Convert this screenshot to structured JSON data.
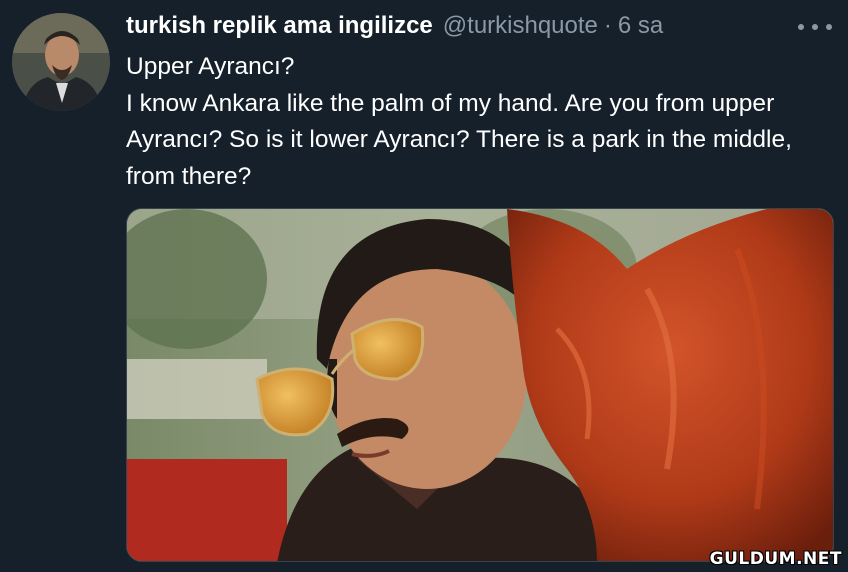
{
  "tweet": {
    "author": {
      "display_name": "turkish replik ama ingilizce",
      "handle": "@turkishquote",
      "avatar_icon": "profile-photo"
    },
    "separator": "·",
    "timestamp": "6 sa",
    "more_icon": "more-horizontal-icon",
    "text_line_1": "Upper Ayrancı?",
    "text_line_2": "I know Ankara like the palm of my hand. Are you from upper Ayrancı? So is it lower Ayrancı? There is a park in the middle, from there?",
    "media": {
      "description_icon": "movie-still-image"
    }
  },
  "watermark": "GULDUM.NET",
  "colors": {
    "background": "#15202b",
    "primary_text": "#ffffff",
    "secondary_text": "#8b98a5",
    "border": "#38444d"
  }
}
